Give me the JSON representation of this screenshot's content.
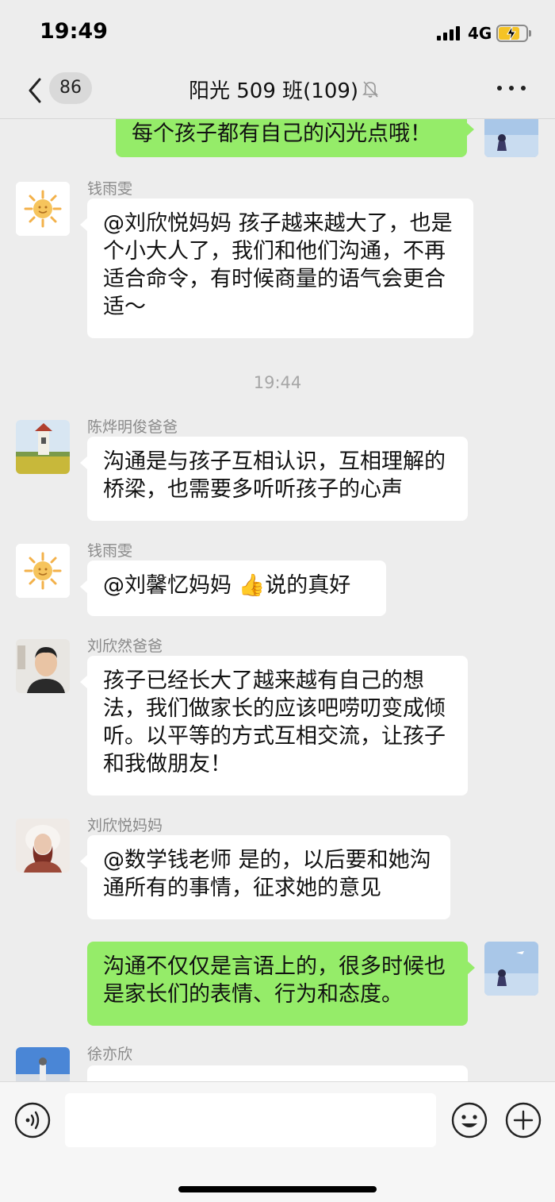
{
  "status_bar": {
    "time": "19:49",
    "network": "4G",
    "icons": [
      "signal-icon",
      "battery-charging-icon"
    ]
  },
  "nav": {
    "unread_count": "86",
    "title": "阳光 509 班(109)",
    "icons": [
      "back-icon",
      "mute-bell-icon",
      "more-icon"
    ]
  },
  "messages": [
    {
      "side": "right",
      "sender": "",
      "text": "每个孩子都有自己的闪光点哦！"
    },
    {
      "side": "left",
      "sender": "钱雨雯",
      "text": "@刘欣悦妈妈 孩子越来越大了，也是个小大人了，我们和他们沟通，不再适合命令，有时候商量的语气会更合适～"
    },
    {
      "side": "left",
      "sender": "陈烨明俊爸爸",
      "text": "沟通是与孩子互相认识，互相理解的桥梁，也需要多听听孩子的心声"
    },
    {
      "side": "left",
      "sender": "钱雨雯",
      "text": "@刘馨忆妈妈 👍说的真好"
    },
    {
      "side": "left",
      "sender": "刘欣然爸爸",
      "text": "孩子已经长大了越来越有自己的想法，我们做家长的应该吧唠叨变成倾听。以平等的方式互相交流，让孩子和我做朋友！"
    },
    {
      "side": "left",
      "sender": "刘欣悦妈妈",
      "text": "@数学钱老师 是的，以后要和她沟通所有的事情，征求她的意见"
    },
    {
      "side": "right",
      "sender": "",
      "text": "沟通不仅仅是言语上的，很多时候也是家长们的表情、行为和态度。"
    },
    {
      "side": "left",
      "sender": "徐亦欣",
      "text": ""
    }
  ],
  "time_separator": "19:44",
  "input_bar": {
    "placeholder": "",
    "icons": [
      "voice-icon",
      "emoji-icon",
      "plus-icon"
    ]
  },
  "colors": {
    "background": "#ededed",
    "outgoing_bubble": "#95ec69",
    "incoming_bubble": "#ffffff",
    "sender_name": "#8a8a8a"
  }
}
